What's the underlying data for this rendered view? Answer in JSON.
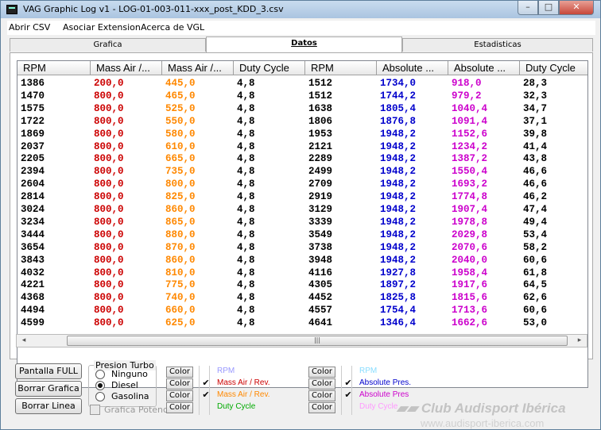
{
  "window": {
    "title": "VAG Graphic Log  v1  -  LOG-01-003-011-xxx_post_KDD_3.csv",
    "min_glyph": "–",
    "max_glyph": "□",
    "close_glyph": "✕"
  },
  "menu": {
    "items": [
      "Abrir CSV",
      "Asociar Extension",
      "Acerca de VGL"
    ]
  },
  "tabs": [
    {
      "label": "Grafica",
      "active": false
    },
    {
      "label": "Datos",
      "active": true
    },
    {
      "label": "Estadisticas",
      "active": false
    }
  ],
  "table": {
    "columns": [
      {
        "label": "RPM",
        "color": "#000000"
      },
      {
        "label": "Mass Air /...",
        "color": "#cc0000"
      },
      {
        "label": "Mass Air /...",
        "color": "#ff8800"
      },
      {
        "label": "Duty Cycle",
        "color": "#000000"
      },
      {
        "label": "RPM",
        "color": "#000000"
      },
      {
        "label": "Absolute ...",
        "color": "#0000cc"
      },
      {
        "label": "Absolute ...",
        "color": "#cc00cc"
      },
      {
        "label": "Duty Cycle",
        "color": "#000000"
      }
    ],
    "rows": [
      [
        "1386",
        "200,0",
        "445,0",
        "4,8",
        "1512",
        "1734,0",
        "918,0",
        "28,3"
      ],
      [
        "1470",
        "800,0",
        "465,0",
        "4,8",
        "1512",
        "1744,2",
        "979,2",
        "32,3"
      ],
      [
        "1575",
        "800,0",
        "525,0",
        "4,8",
        "1638",
        "1805,4",
        "1040,4",
        "34,7"
      ],
      [
        "1722",
        "800,0",
        "550,0",
        "4,8",
        "1806",
        "1876,8",
        "1091,4",
        "37,1"
      ],
      [
        "1869",
        "800,0",
        "580,0",
        "4,8",
        "1953",
        "1948,2",
        "1152,6",
        "39,8"
      ],
      [
        "2037",
        "800,0",
        "610,0",
        "4,8",
        "2121",
        "1948,2",
        "1234,2",
        "41,4"
      ],
      [
        "2205",
        "800,0",
        "665,0",
        "4,8",
        "2289",
        "1948,2",
        "1387,2",
        "43,8"
      ],
      [
        "2394",
        "800,0",
        "735,0",
        "4,8",
        "2499",
        "1948,2",
        "1550,4",
        "46,6"
      ],
      [
        "2604",
        "800,0",
        "800,0",
        "4,8",
        "2709",
        "1948,2",
        "1693,2",
        "46,6"
      ],
      [
        "2814",
        "800,0",
        "825,0",
        "4,8",
        "2919",
        "1948,2",
        "1774,8",
        "46,2"
      ],
      [
        "3024",
        "800,0",
        "860,0",
        "4,8",
        "3129",
        "1948,2",
        "1907,4",
        "47,4"
      ],
      [
        "3234",
        "800,0",
        "865,0",
        "4,8",
        "3339",
        "1948,2",
        "1978,8",
        "49,4"
      ],
      [
        "3444",
        "800,0",
        "880,0",
        "4,8",
        "3549",
        "1948,2",
        "2029,8",
        "53,4"
      ],
      [
        "3654",
        "800,0",
        "870,0",
        "4,8",
        "3738",
        "1948,2",
        "2070,6",
        "58,2"
      ],
      [
        "3843",
        "800,0",
        "860,0",
        "4,8",
        "3948",
        "1948,2",
        "2040,0",
        "60,6"
      ],
      [
        "4032",
        "800,0",
        "810,0",
        "4,8",
        "4116",
        "1927,8",
        "1958,4",
        "61,8"
      ],
      [
        "4221",
        "800,0",
        "775,0",
        "4,8",
        "4305",
        "1897,2",
        "1917,6",
        "64,5"
      ],
      [
        "4368",
        "800,0",
        "740,0",
        "4,8",
        "4452",
        "1825,8",
        "1815,6",
        "62,6"
      ],
      [
        "4494",
        "800,0",
        "660,0",
        "4,8",
        "4557",
        "1754,4",
        "1713,6",
        "60,6"
      ],
      [
        "4599",
        "800,0",
        "625,0",
        "4,8",
        "4641",
        "1346,4",
        "1662,6",
        "53,0"
      ]
    ]
  },
  "scrollbar": {
    "left_arrow": "◂",
    "right_arrow": "▸",
    "thumb_grip": "|||"
  },
  "buttons": {
    "pantalla_full": "Pantalla  FULL",
    "borrar_grafica": "Borrar Grafica",
    "borrar_linea": "Borrar Linea"
  },
  "presion_turbo": {
    "title": "Presion Turbo",
    "options": [
      {
        "label": "Ninguno",
        "selected": false
      },
      {
        "label": "Diesel",
        "selected": true
      },
      {
        "label": "Gasolina",
        "selected": false
      }
    ],
    "grafica_potencia": "Grafica Potencia"
  },
  "color_button_label": "Color",
  "series_left": [
    {
      "label": "RPM",
      "color": "#9999ff",
      "checked": false
    },
    {
      "label": "Mass Air / Rev.",
      "color": "#cc0000",
      "checked": true
    },
    {
      "label": "Mass Air / Rev.",
      "color": "#ff8800",
      "checked": true
    },
    {
      "label": "Duty Cycle",
      "color": "#00aa00",
      "checked": false
    }
  ],
  "series_right": [
    {
      "label": "RPM",
      "color": "#88ddff",
      "checked": false
    },
    {
      "label": "Absolute Pres.",
      "color": "#0000cc",
      "checked": true
    },
    {
      "label": "Absolute Pres",
      "color": "#cc00cc",
      "checked": true
    },
    {
      "label": "Duty Cycle",
      "color": "#ff99ff",
      "checked": false
    }
  ],
  "check_glyph": "✔",
  "watermark": {
    "line1": "▰▰  Club Audisport Ibérica",
    "line2": "www.audisport-iberica.com"
  }
}
